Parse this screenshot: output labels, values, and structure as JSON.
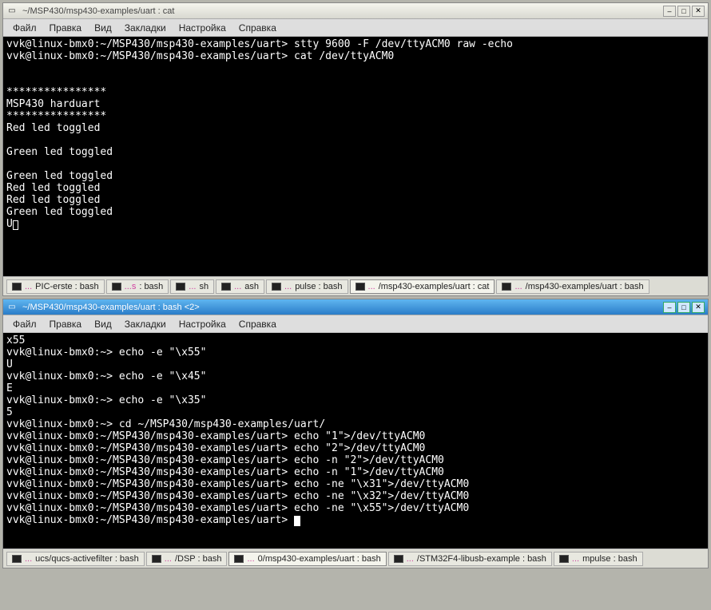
{
  "window1": {
    "title": "~/MSP430/msp430-examples/uart : cat",
    "menus": [
      "Файл",
      "Правка",
      "Вид",
      "Закладки",
      "Настройка",
      "Справка"
    ],
    "content": "vvk@linux-bmx0:~/MSP430/msp430-examples/uart> stty 9600 -F /dev/ttyACM0 raw -echo\nvvk@linux-bmx0:~/MSP430/msp430-examples/uart> cat /dev/ttyACM0\n\n\n****************\nMSP430 harduart\n****************\nRed led toggled\n\nGreen led toggled\n\nGreen led toggled\nRed led toggled\nRed led toggled\nGreen led toggled",
    "last_line": "U",
    "tabs": [
      {
        "ellipsis": "...",
        "main": "PIC-erste : bash",
        "active": false
      },
      {
        "ellipsis": "...s",
        "main": " : bash",
        "active": false
      },
      {
        "ellipsis": "...",
        "main": "sh",
        "active": false
      },
      {
        "ellipsis": "...",
        "main": "ash",
        "active": false
      },
      {
        "ellipsis": "...",
        "main": "pulse : bash",
        "active": false
      },
      {
        "ellipsis": "...",
        "main": "/msp430-examples/uart : cat",
        "active": true
      },
      {
        "ellipsis": "...",
        "main": "/msp430-examples/uart : bash",
        "active": false
      }
    ]
  },
  "window2": {
    "title": "~/MSP430/msp430-examples/uart : bash <2>",
    "menus": [
      "Файл",
      "Правка",
      "Вид",
      "Закладки",
      "Настройка",
      "Справка"
    ],
    "content": "x55\nvvk@linux-bmx0:~> echo -e \"\\x55\"\nU\nvvk@linux-bmx0:~> echo -e \"\\x45\"\nE\nvvk@linux-bmx0:~> echo -e \"\\x35\"\n5\nvvk@linux-bmx0:~> cd ~/MSP430/msp430-examples/uart/\nvvk@linux-bmx0:~/MSP430/msp430-examples/uart> echo \"1\">/dev/ttyACM0\nvvk@linux-bmx0:~/MSP430/msp430-examples/uart> echo \"2\">/dev/ttyACM0\nvvk@linux-bmx0:~/MSP430/msp430-examples/uart> echo -n \"2\">/dev/ttyACM0\nvvk@linux-bmx0:~/MSP430/msp430-examples/uart> echo -n \"1\">/dev/ttyACM0\nvvk@linux-bmx0:~/MSP430/msp430-examples/uart> echo -ne \"\\x31\">/dev/ttyACM0\nvvk@linux-bmx0:~/MSP430/msp430-examples/uart> echo -ne \"\\x32\">/dev/ttyACM0\nvvk@linux-bmx0:~/MSP430/msp430-examples/uart> echo -ne \"\\x55\">/dev/ttyACM0",
    "last_line": "vvk@linux-bmx0:~/MSP430/msp430-examples/uart> ",
    "tabs": [
      {
        "ellipsis": "...",
        "main": "ucs/qucs-activefilter : bash",
        "active": false
      },
      {
        "ellipsis": "...",
        "main": "/DSP : bash",
        "active": false
      },
      {
        "ellipsis": "...",
        "main": "0/msp430-examples/uart : bash",
        "active": true
      },
      {
        "ellipsis": "...",
        "main": "/STM32F4-libusb-example : bash",
        "active": false
      },
      {
        "ellipsis": "...",
        "main": "mpulse : bash",
        "active": false
      }
    ]
  }
}
